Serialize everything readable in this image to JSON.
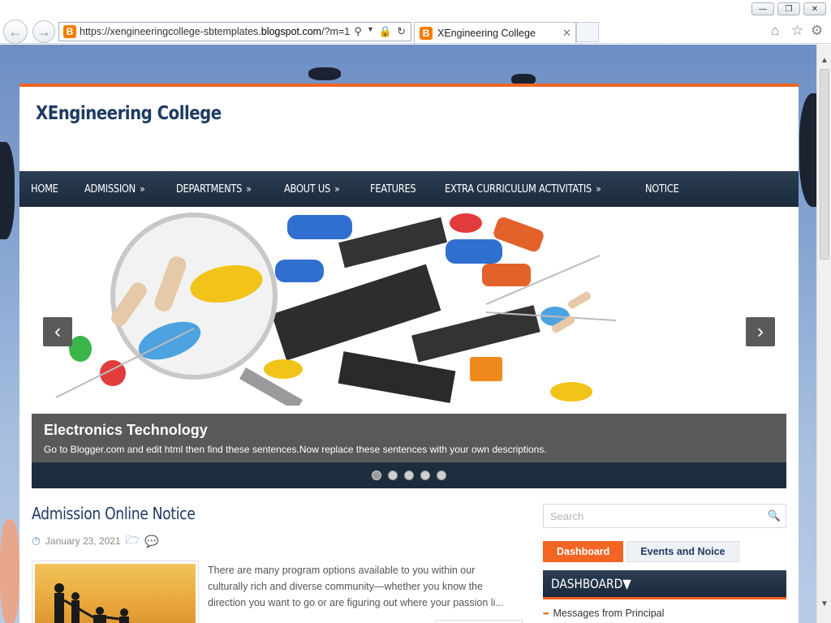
{
  "browser": {
    "url_prefix": "https://xengineeringcollege-sbtemplates.",
    "url_domain": "blogspot.com",
    "url_suffix": "/?m=1",
    "tab_title": "XEngineering College",
    "favicon_letter": "B"
  },
  "site": {
    "title": "XEngineering College",
    "menu": [
      {
        "label": "HOME",
        "has_sub": false
      },
      {
        "label": "ADMISSION",
        "has_sub": true
      },
      {
        "label": "DEPARTMENTS",
        "has_sub": true
      },
      {
        "label": "ABOUT US",
        "has_sub": true
      },
      {
        "label": "FEATURES",
        "has_sub": false
      },
      {
        "label": "EXTRA CURRICULUM ACTIVITATIS",
        "has_sub": true
      },
      {
        "label": "NOTICE",
        "has_sub": false
      }
    ],
    "submenu_marker": "»"
  },
  "slider": {
    "prev_icon": "‹",
    "next_icon": "›",
    "caption_title": "Electronics Technology",
    "caption_text": "Go to Blogger.com and edit html then find these sentences.Now replace these sentences with your own descriptions.",
    "dots": 5,
    "active_dot": 0
  },
  "post": {
    "title": "Admission Online Notice",
    "date": "January 23, 2021",
    "excerpt": "There are many program options available to you within our culturally rich and diverse community—whether you know the direction you want to go or are figuring out where your passion li..."
  },
  "sidebar": {
    "search_placeholder": "Search",
    "tabs": [
      "Dashboard",
      "Events and Noice"
    ],
    "active_tab": 0,
    "dashboard_heading": "DASHBOARD▼",
    "dashboard_items": [
      "Messages from Principal"
    ]
  },
  "colors": {
    "accent": "#f26522",
    "nav_dark": "#1b2a3b",
    "title_blue": "#1f3b63"
  }
}
